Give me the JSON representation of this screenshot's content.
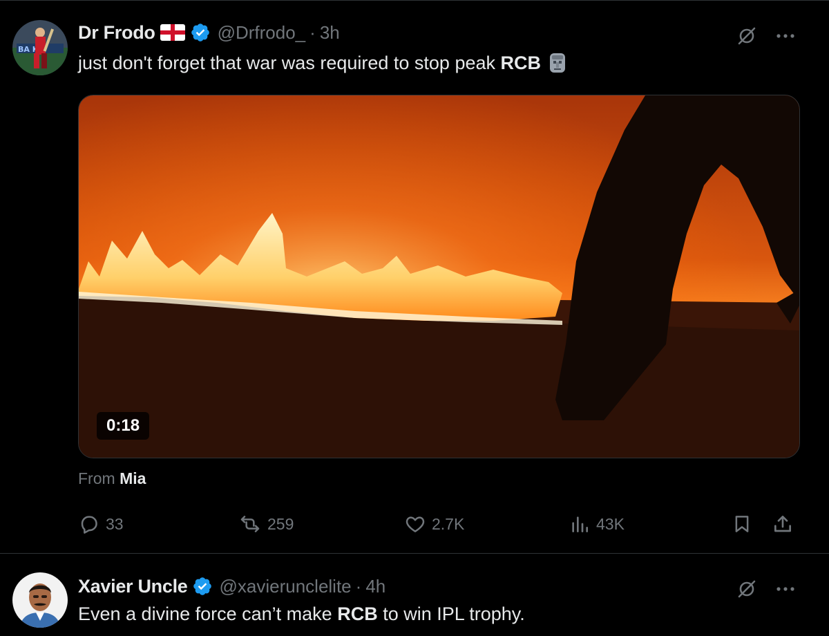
{
  "tweets": [
    {
      "display_name": "Dr Frodo",
      "flag_icon": "england-flag-icon",
      "verified_icon": "verified-badge-icon",
      "handle": "@Drfrodo_",
      "separator": "·",
      "time": "3h",
      "text_before": "just don't forget that war was required to stop peak ",
      "text_bold": "RCB",
      "emoji_icon": "moai-emoji-icon",
      "media": {
        "type": "video",
        "duration": "0:18"
      },
      "from_label": "From",
      "from_name": "Mia",
      "actions": {
        "replies": "33",
        "reposts": "259",
        "likes": "2.7K",
        "views": "43K"
      }
    },
    {
      "display_name": "Xavier Uncle",
      "verified_icon": "verified-badge-icon",
      "handle": "@xavierunclelite",
      "separator": "·",
      "time": "4h",
      "text_before": "Even a divine force can’t make ",
      "text_bold": "RCB",
      "text_after": " to win IPL trophy."
    }
  ],
  "colors": {
    "background": "#000000",
    "text": "#e7e9ea",
    "muted": "#71767b",
    "verified": "#1d9bf0",
    "divider": "#2f3336"
  }
}
